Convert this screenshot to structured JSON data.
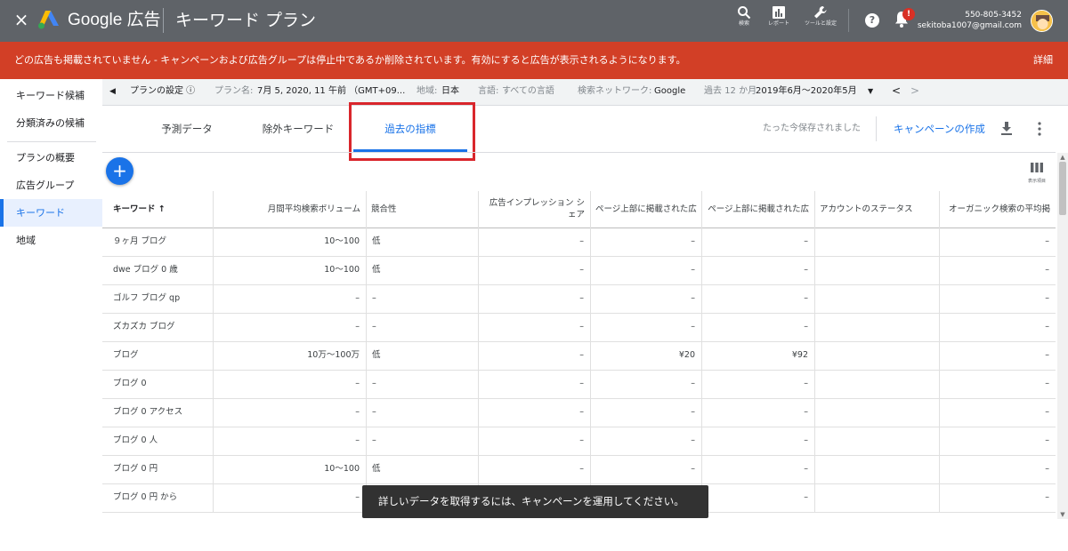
{
  "header": {
    "close_label": "×",
    "product_name": "Google 広告",
    "page_title": "キーワード プラン",
    "icons": [
      {
        "name": "search-icon",
        "caption": "検索"
      },
      {
        "name": "reports-icon",
        "caption": "レポート"
      },
      {
        "name": "tools-icon",
        "caption": "ツールと設定"
      }
    ],
    "help_glyph": "?",
    "notification_badge": "!",
    "account_phone": "550-805-3452",
    "account_email": "sekitoba1007@gmail.com"
  },
  "alert": {
    "message": "どの広告も掲載されていません - キャンペーンおよび広告グループは停止中であるか削除されています。有効にすると広告が表示されるようになります。",
    "detail_link": "詳細",
    "color": "#d23f26"
  },
  "sidebar": {
    "items": [
      {
        "label": "キーワード候補",
        "active": false
      },
      {
        "label": "分類済みの候補",
        "active": false
      },
      {
        "label": "プランの概要",
        "active": false
      },
      {
        "label": "広告グループ",
        "active": false
      },
      {
        "label": "キーワード",
        "active": true
      },
      {
        "label": "地域",
        "active": false
      }
    ]
  },
  "filterbar": {
    "collapse_glyph": "◀",
    "plan_settings": "プランの設定 ⓘ",
    "plan_name_label": "プラン名:",
    "plan_name_value": "7月 5, 2020, 11 午前 （GMT+09...",
    "region_label": "地域:",
    "region_value": "日本",
    "language_label": "言語:",
    "language_value": "すべての言語",
    "network_label": "検索ネットワーク:",
    "network_value": "Google",
    "period_label": "過去 12 か月",
    "period_value": "2019年6月～2020年5月",
    "dropdown_glyph": "▼",
    "prev_glyph": "<",
    "next_glyph": ">"
  },
  "tabs": [
    {
      "label": "予測データ",
      "active": false
    },
    {
      "label": "除外キーワード",
      "active": false
    },
    {
      "label": "過去の指標",
      "active": true
    }
  ],
  "toolbar": {
    "saved_status": "たった今保存されました",
    "create_campaign": "キャンペーンの作成",
    "fab_label": "+",
    "columns_caption": "表示項目"
  },
  "table": {
    "headers": [
      "キーワード ↑",
      "月間平均検索ボリューム",
      "競合性",
      "広告インプレッション シェア",
      "ページ上部に掲載された広",
      "ページ上部に掲載された広",
      "アカウントのステータス",
      "オーガニック検索の平均掲"
    ],
    "rows": [
      [
        "９ヶ月 ブログ",
        "10～100",
        "低",
        "–",
        "–",
        "–",
        "",
        "–"
      ],
      [
        "dwe ブログ 0 歳",
        "10～100",
        "低",
        "–",
        "–",
        "–",
        "",
        "–"
      ],
      [
        "ゴルフ ブログ qp",
        "–",
        "–",
        "–",
        "–",
        "–",
        "",
        "–"
      ],
      [
        "ズカズカ ブログ",
        "–",
        "–",
        "–",
        "–",
        "–",
        "",
        "–"
      ],
      [
        "ブログ",
        "10万～100万",
        "低",
        "–",
        "¥20",
        "¥92",
        "",
        "–"
      ],
      [
        "ブログ 0",
        "–",
        "–",
        "–",
        "–",
        "–",
        "",
        "–"
      ],
      [
        "ブログ 0 アクセス",
        "–",
        "–",
        "–",
        "–",
        "–",
        "",
        "–"
      ],
      [
        "ブログ 0 人",
        "–",
        "–",
        "–",
        "–",
        "–",
        "",
        "–"
      ],
      [
        "ブログ 0 円",
        "10～100",
        "低",
        "–",
        "–",
        "–",
        "",
        "–"
      ],
      [
        "ブログ 0 円 から",
        "–",
        "",
        "",
        "",
        "–",
        "",
        "–"
      ]
    ]
  },
  "toast": {
    "message": "詳しいデータを取得するには、キャンペーンを運用してください。"
  },
  "colors": {
    "header_bg": "#5f6368",
    "accent": "#1a73e8",
    "highlight": "#d9262c",
    "toast_bg": "#323232"
  }
}
